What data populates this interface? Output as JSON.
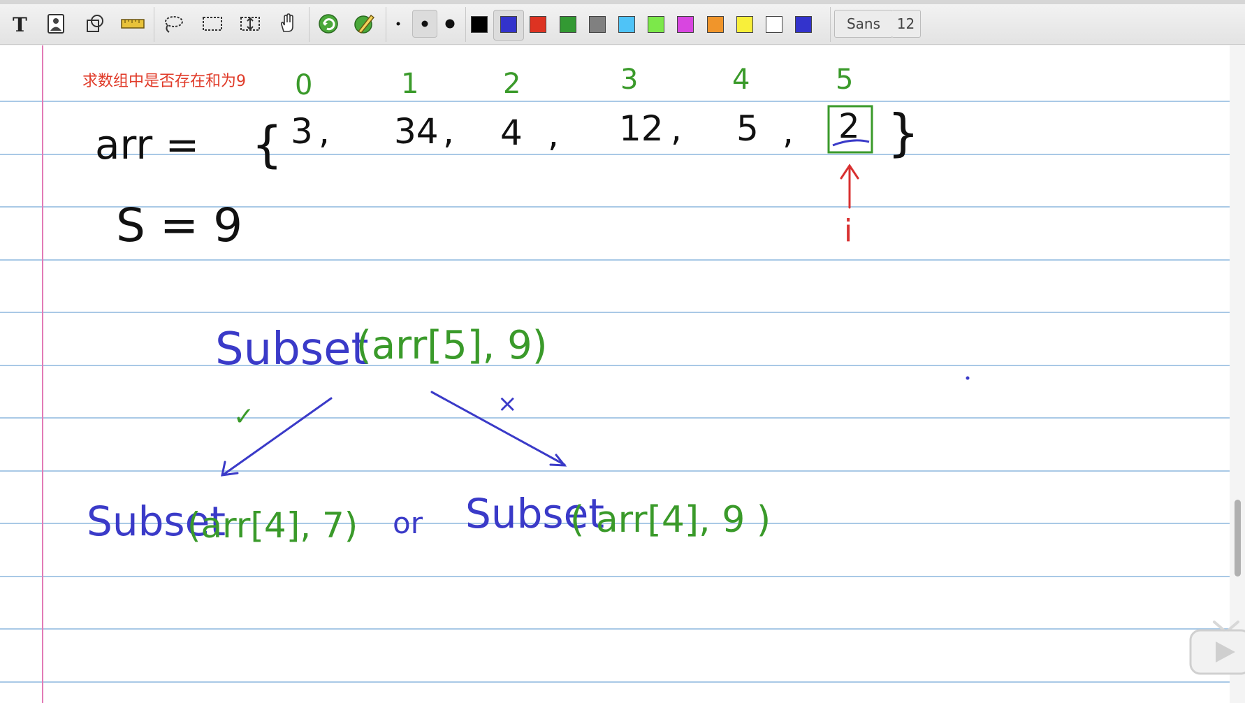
{
  "toolbar": {
    "tools": [
      {
        "name": "text-tool-icon"
      },
      {
        "name": "image-tool-icon"
      },
      {
        "name": "shape-tool-icon"
      },
      {
        "name": "ruler-tool-icon"
      },
      {
        "name": "lasso-tool-icon"
      },
      {
        "name": "rect-select-tool-icon"
      },
      {
        "name": "vertical-space-tool-icon"
      },
      {
        "name": "hand-tool-icon"
      },
      {
        "name": "shape-recognizer-icon"
      },
      {
        "name": "default-pen-icon"
      }
    ],
    "thickness_active": "medium",
    "colors": [
      "#000000",
      "#3333cc",
      "#dd3322",
      "#339933",
      "#808080",
      "#4fc3f7",
      "#7ce84a",
      "#d846e0",
      "#f0952b",
      "#f8ef3a",
      "#ffffff",
      "#3333cc"
    ],
    "active_color": "#3333cc",
    "font_name": "Sans",
    "font_size": "12"
  },
  "note": {
    "title": "求数组中是否存在和为9",
    "title_color": "#e03a28",
    "ink": {
      "indices": [
        "0",
        "1",
        "2",
        "3",
        "4",
        "5"
      ],
      "array_label": "arr =",
      "array_values": [
        "3",
        "34",
        "4",
        "12",
        "5",
        "2"
      ],
      "sum_label": "S = 9",
      "pointer_label": "i",
      "root_call_name": "Subset",
      "root_call_args": "(arr[5], 9)",
      "check_mark": "✓",
      "cross_mark": "×",
      "left_call_name": "Subset",
      "left_call_args": "(arr[4], 7)",
      "or_word": "or",
      "right_call_name": "Subset",
      "right_call_args": "( arr[4], 9 )"
    },
    "ink_colors": {
      "black": "#111111",
      "green": "#3a9a2a",
      "blue": "#3a3ac8",
      "red": "#d83030"
    }
  }
}
